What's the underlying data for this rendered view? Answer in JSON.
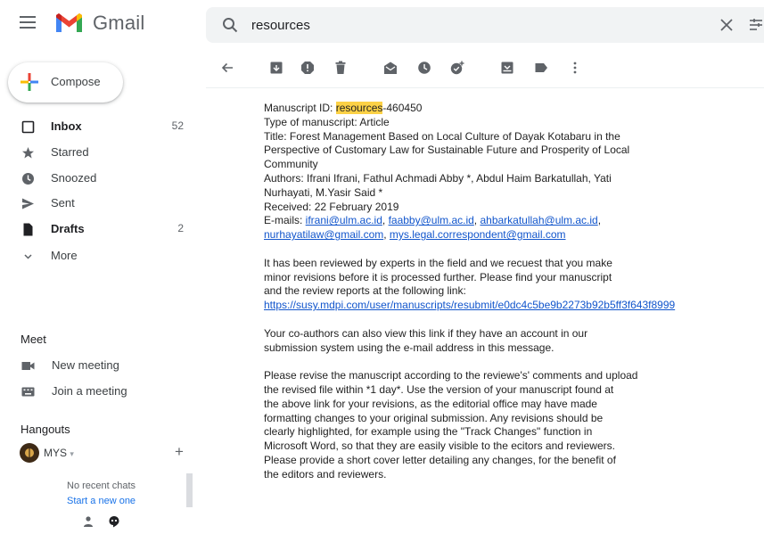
{
  "app": {
    "name": "Gmail"
  },
  "search": {
    "value": "resources",
    "clear_icon": "close-icon",
    "options_icon": "tune-icon"
  },
  "compose": {
    "label": "Compose"
  },
  "nav": [
    {
      "label": "Inbox",
      "count": "52",
      "bold": true,
      "icon": "inbox-icon"
    },
    {
      "label": "Starred",
      "count": "",
      "bold": false,
      "icon": "star-icon"
    },
    {
      "label": "Snoozed",
      "count": "",
      "bold": false,
      "icon": "clock-icon"
    },
    {
      "label": "Sent",
      "count": "",
      "bold": false,
      "icon": "send-icon"
    },
    {
      "label": "Drafts",
      "count": "2",
      "bold": true,
      "icon": "draft-icon"
    },
    {
      "label": "More",
      "count": "",
      "bold": false,
      "icon": "chevron-down-icon"
    }
  ],
  "meet": {
    "title": "Meet",
    "items": [
      {
        "label": "New meeting",
        "icon": "video-icon"
      },
      {
        "label": "Join a meeting",
        "icon": "keyboard-icon"
      }
    ]
  },
  "hangouts": {
    "title": "Hangouts",
    "user": "MYS",
    "no_chats": "No recent chats",
    "start_chat": "Start a new one"
  },
  "toolbar": {
    "icons": [
      "back-arrow-icon",
      "archive-icon",
      "report-spam-icon",
      "delete-icon",
      "mark-unread-icon",
      "snooze-icon",
      "add-task-icon",
      "move-to-icon",
      "label-icon",
      "more-vert-icon"
    ]
  },
  "message": {
    "manuscript_prefix": "Manuscript ID: ",
    "manuscript_highlight": "resources",
    "manuscript_suffix": "-460450",
    "type": "Type of manuscript: Article",
    "title_1": "Title: Forest Management Based on Local Culture of Dayak Kotabaru in the",
    "title_2": "Perspective of Customary Law for Sustainable Future and Prosperity of Local",
    "title_3": "Community",
    "authors_1": "Authors: Ifrani Ifrani, Fathul Achmadi Abby *, Abdul Haim Barkatullah, Yati",
    "authors_2": "Nurhayati, M.Yasir Said *",
    "received": "Received: 22 February 2019",
    "emails_prefix": "E-mails: ",
    "email_1": "ifrani@ulm.ac.id",
    "email_2": "faabby@ulm.ac.id",
    "email_3": "ahbarkatullah@ulm.ac.id",
    "email_4": "nurhayatilaw@gmail.com",
    "email_5": "mys.legal.correspondent@gmail.com",
    "p1_1": "It has been reviewed by experts in the field and we recuest that you make",
    "p1_2": "minor revisions before it is processed further. Please find your manuscript",
    "p1_3": "and the review reports at the following link:",
    "review_link": "https://susy.mdpi.com/user/manuscripts/resubmit/e0dc4c5be9b2273b92b5ff3f643f8999",
    "p2_1": "Your co-authors can also view this link if they have an account in our",
    "p2_2": "submission system using the e-mail address in this message.",
    "p3_1": "Please revise the manuscript according to the reviewe's' comments and upload",
    "p3_2": "the revised file within *1 day*. Use the version of your manuscript found at",
    "p3_3": "the above link for your revisions, as the editorial office may have made",
    "p3_4": "formatting changes to your original submission. Any revisions should be",
    "p3_5": "clearly highlighted, for example using the \"Track Changes\" function in",
    "p3_6": "Microsoft Word, so that they are easily visible to the ecitors and reviewers.",
    "p3_7": "Please provide a short cover letter detailing any changes, for the benefit of",
    "p3_8": "the editors and reviewers."
  }
}
